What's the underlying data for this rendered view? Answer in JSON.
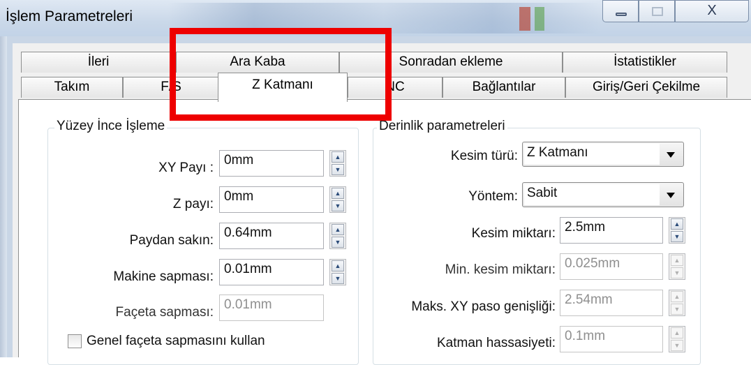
{
  "window": {
    "title": "İşlem Parametreleri",
    "controls": {
      "minimize": "–",
      "maximize": "□",
      "close": "X"
    }
  },
  "tabs": {
    "row1": [
      "İleri",
      "Ara Kaba",
      "Sonradan ekleme",
      "İstatistikler"
    ],
    "row2": [
      "Takım",
      "F/S",
      "Z Katmanı",
      "NC",
      "Bağlantılar",
      "Giriş/Geri Çekilme"
    ],
    "active": "Z Katmanı"
  },
  "surface": {
    "title": "Yüzey İnce İşleme",
    "xy_label": "XY Payı :",
    "xy_value": "0mm",
    "z_label": "Z payı:",
    "z_value": "0mm",
    "avoid_label": "Paydan sakın:",
    "avoid_value": "0.64mm",
    "machine_label": "Makine sapması:",
    "machine_value": "0.01mm",
    "facet_label": "Façeta sapması:",
    "facet_value": "0.01mm",
    "general_label": "Genel façeta sapmasını kullan",
    "general_checked": false
  },
  "depth": {
    "title": "Derinlik parametreleri",
    "cut_type_label": "Kesim türü:",
    "cut_type_value": "Z Katmanı",
    "method_label": "Yöntem:",
    "method_value": "Sabit",
    "cut_amount_label": "Kesim miktarı:",
    "cut_amount_value": "2.5mm",
    "min_cut_label": "Min. kesim miktarı:",
    "min_cut_value": "0.025mm",
    "max_xy_label": "Maks. XY paso genişliği:",
    "max_xy_value": "2.54mm",
    "layer_label": "Katman hassasiyeti:",
    "layer_value": "0.1mm"
  },
  "colors": {
    "highlight": "#ee0000",
    "titlebar": "#cad8e9",
    "disabled_text": "#8f8f8f"
  }
}
